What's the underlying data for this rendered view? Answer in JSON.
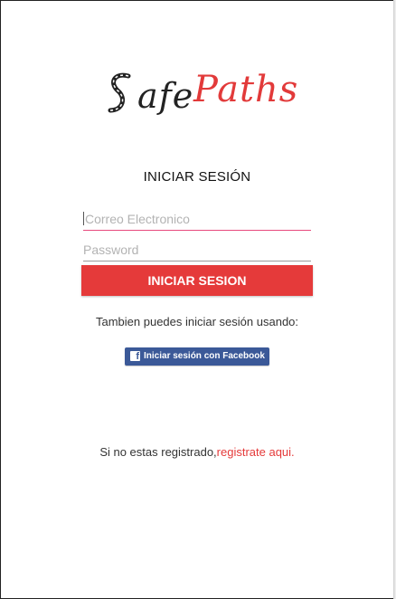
{
  "logo": {
    "part1": "afe",
    "part2": "Paths",
    "full_text": "SafePaths"
  },
  "login": {
    "title": "INICIAR SESIÓN",
    "email_placeholder": "Correo Electronico",
    "password_placeholder": "Password",
    "button_label": "INICIAR SESION"
  },
  "alt_login": {
    "text": "Tambien puedes iniciar sesión usando:",
    "facebook_label": "Iniciar sesión con Facebook",
    "facebook_icon": "facebook-icon"
  },
  "register": {
    "prefix": "Si no estas registrado,",
    "link": "registrate aqui."
  },
  "colors": {
    "accent": "#e53a3a",
    "facebook": "#3b5998",
    "field_focus": "#e8497d"
  }
}
